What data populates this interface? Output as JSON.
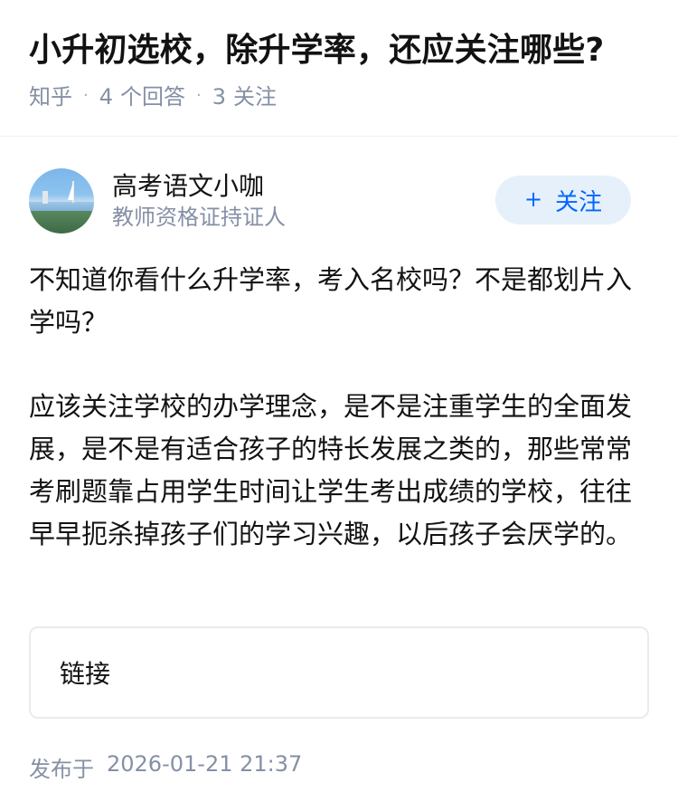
{
  "question": {
    "title": "小升初选校，除升学率，还应关注哪些?",
    "source": "知乎",
    "answers_count": "4",
    "answers_label": "个回答",
    "followers_count": "3",
    "followers_label": "关注",
    "separator": "·"
  },
  "author": {
    "name": "高考语文小咖",
    "badge": "教师资格证持证人",
    "follow_plus": "+",
    "follow_label": "关注"
  },
  "answer": {
    "paragraphs": [
      "不知道你看什么升学率，考入名校吗？不是都划片入学吗？",
      "应该关注学校的办学理念，是不是注重学生的全面发展，是不是有适合孩子的特长发展之类的，那些常常考刷题靠占用学生时间让学生考出成绩的学校，往往早早扼杀掉孩子们的学习兴趣，以后孩子会厌学的。"
    ],
    "link_card_label": "链接",
    "published_label": "发布于",
    "published_time": "2026-01-21 21:37"
  },
  "colors": {
    "accent": "#0066ff",
    "follow_bg": "#e5f0fb",
    "meta_text": "#8590a6",
    "main_text": "#121212"
  }
}
